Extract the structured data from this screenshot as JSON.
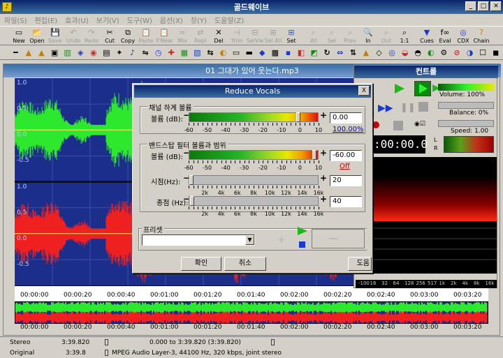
{
  "app": {
    "title": "골드웨이브",
    "icon": "goldwave-icon"
  },
  "menu": [
    "파일(S)",
    "편집(E)",
    "효과(U)",
    "보기(V)",
    "도구(W)",
    "옵션(X)",
    "창(Y)",
    "도움말(Z)"
  ],
  "toolbar": [
    {
      "label": "New",
      "icon": "new-icon",
      "enabled": true
    },
    {
      "label": "Open",
      "icon": "open-icon",
      "enabled": true
    },
    {
      "label": "Save",
      "icon": "save-icon",
      "enabled": false
    },
    {
      "label": "Undo",
      "icon": "undo-icon",
      "enabled": false
    },
    {
      "label": "Redo",
      "icon": "redo-icon",
      "enabled": false
    },
    {
      "label": "Cut",
      "icon": "cut-icon",
      "enabled": true
    },
    {
      "label": "Copy",
      "icon": "copy-icon",
      "enabled": true
    },
    {
      "label": "Paste",
      "icon": "paste-icon",
      "enabled": false
    },
    {
      "label": "P.New",
      "icon": "paste-new-icon",
      "enabled": false
    },
    {
      "label": "Mix",
      "icon": "mix-icon",
      "enabled": false
    },
    {
      "label": "Repl",
      "icon": "replace-icon",
      "enabled": false
    },
    {
      "label": "Del",
      "icon": "delete-icon",
      "enabled": true
    },
    {
      "label": "Trim",
      "icon": "trim-icon",
      "enabled": false
    },
    {
      "label": "SelVw",
      "icon": "select-view-icon",
      "enabled": false
    },
    {
      "label": "Sel All",
      "icon": "select-all-icon",
      "enabled": false
    },
    {
      "label": "Set",
      "icon": "set-icon",
      "enabled": true
    },
    {
      "label": "All",
      "icon": "zoom-all-icon",
      "enabled": false
    },
    {
      "label": "Sel",
      "icon": "zoom-sel-icon",
      "enabled": false
    },
    {
      "label": "Prev",
      "icon": "zoom-prev-icon",
      "enabled": false
    },
    {
      "label": "In",
      "icon": "zoom-in-icon",
      "enabled": true
    },
    {
      "label": "Out",
      "icon": "zoom-out-icon",
      "enabled": false
    },
    {
      "label": "1:1",
      "icon": "zoom-1-1-icon",
      "enabled": true
    },
    {
      "label": "Cues",
      "icon": "cues-icon",
      "enabled": true
    },
    {
      "label": "Eval",
      "icon": "eval-icon",
      "enabled": true
    },
    {
      "label": "CDX",
      "icon": "cdx-icon",
      "enabled": true
    },
    {
      "label": "Chain",
      "icon": "chain-icon",
      "enabled": true
    }
  ],
  "effects_icons": [
    "volume-icon",
    "fade-in-icon",
    "fade-out-icon",
    "compressor-icon",
    "equalizer-icon",
    "echo-icon",
    "flanger-icon",
    "doppler-icon",
    "mechanize-icon",
    "pitch-icon",
    "reverse-icon",
    "time-warp-icon",
    "noise-icon",
    "filter-icon",
    "stereo-icon",
    "offset-icon",
    "resample-icon",
    "silence-icon",
    "insert-icon",
    "repair-icon",
    "spectrum-icon",
    "bass-icon",
    "channel-icon",
    "special-icon",
    "loop-icon",
    "pan-icon",
    "invert-icon",
    "amp-icon",
    "decl-icon",
    "declick-icon",
    "autogain-icon",
    "copy-fx-icon",
    "paste-fx-icon",
    "timestamp-icon",
    "remove-icon",
    "color-icon",
    "unknown-icon",
    "block-icon"
  ],
  "wave": {
    "title": "01 그대가 있어 웃는다.mp3",
    "y_labels_top": [
      "1.0",
      "0.5",
      "0.0",
      "-0.5"
    ],
    "y_labels_bottom": [
      "1.0",
      "0.5",
      "0.0",
      "-0.5"
    ],
    "time_labels": [
      "00:00:00",
      "00:00:20",
      "00:00:40",
      "00:01:00",
      "00:01:20",
      "00:01:40",
      "00:02:00",
      "00:02:20",
      "00:02:40",
      "00:03:00",
      "00:03:20"
    ]
  },
  "control": {
    "title": "컨트롤",
    "volume": "Volume: 100%",
    "balance": "Balance: 0%",
    "speed": "Speed: 1.00",
    "time": ":00:00.0",
    "left_label": "L",
    "right_label": "R",
    "freq_labels": [
      "-100",
      "16",
      "32",
      "64",
      "128",
      "256",
      "517",
      "1k",
      "2k",
      "4k",
      "8k",
      "16k"
    ]
  },
  "dialog": {
    "title": "Reduce Vocals",
    "close": "X",
    "channel_group": "채널 하계 볼륨",
    "channel_volume_label": "볼륨 (dB):",
    "channel_volume_value": "0.00",
    "channel_percent": "100.00%",
    "channel_volume_db": 0,
    "scale1": [
      "-60",
      "-50",
      "-40",
      "-30",
      "-20",
      "-10",
      "0",
      "10"
    ],
    "band_group": "밴드스탑 필터 볼륨과 범위",
    "band_volume_label": "볼륨 (dB):",
    "band_volume_value": "-60.00",
    "band_off": "Off",
    "band_volume_db": -60,
    "start_label": "시점(Hz):",
    "start_value": "20",
    "end_label": "종점 (Hz):",
    "end_value": "40",
    "freq_scale": [
      "2k",
      "4k",
      "6k",
      "8k",
      "10k",
      "12k",
      "14k",
      "16k"
    ],
    "preset_label": "프리셋",
    "ok": "확인",
    "cancel": "취소",
    "help": "도움"
  },
  "status": {
    "row1": {
      "channel": "Stereo",
      "length": "3:39.820",
      "selection": "0.000 to 3:39.820 (3:39.820)"
    },
    "row2": {
      "original": "Original",
      "length": "3:39.8",
      "format": "MPEG Audio Layer-3, 44100 Hz, 320 kbps, joint stereo"
    }
  },
  "colors": {
    "wave_bg": "#1a2e8a",
    "left_channel": "#2ee82e",
    "right_channel": "#ee2020",
    "accent": "#0a246a"
  }
}
